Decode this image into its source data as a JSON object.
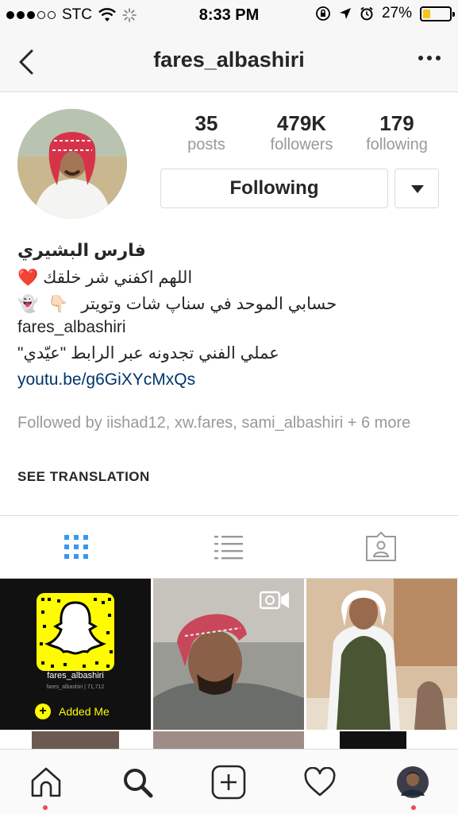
{
  "status_bar": {
    "carrier": "STC",
    "time": "8:33 PM",
    "battery_percent": "27%",
    "battery_level": 0.27,
    "signal_bars_filled": 3,
    "signal_bars_total": 5,
    "battery_color": "#f5c518"
  },
  "nav": {
    "title": "fares_albashiri",
    "back_icon": "chevron-left-icon",
    "more_icon": "more-horizontal-icon"
  },
  "profile": {
    "stats": [
      {
        "value": "35",
        "label": "posts"
      },
      {
        "value": "479K",
        "label": "followers"
      },
      {
        "value": "179",
        "label": "following"
      }
    ],
    "following_button": "Following",
    "dropdown_icon": "caret-down-icon"
  },
  "bio": {
    "name": "فارس البشيري",
    "line1": "اللهم اكفني شر خلقك",
    "line1_emoji": "❤️",
    "line2": "حسابي الموحد في سناپ شات وتويتر",
    "line2_emoji_1": "👇🏻",
    "line2_emoji_2": "👻",
    "line3": "fares_albashiri",
    "line4": "عملي الفني تجدونه عبر الرابط \"عيّدي\"",
    "link": "youtu.be/g6GiXYcMxQs"
  },
  "followed_by": "Followed by iishad12, xw.fares, sami_albashiri + 6 more",
  "see_translation": "SEE TRANSLATION",
  "tabs": [
    {
      "icon": "grid-icon",
      "active": true
    },
    {
      "icon": "list-icon",
      "active": false
    },
    {
      "icon": "tagged-icon",
      "active": false
    }
  ],
  "posts": {
    "snapcode": {
      "username": "fares_albashiri",
      "subtext": "fares_albashiri | 71,712",
      "added_label": "Added Me"
    }
  },
  "bottom_nav": [
    {
      "icon": "home-icon",
      "notification": true
    },
    {
      "icon": "search-icon",
      "notification": false
    },
    {
      "icon": "add-post-icon",
      "notification": false
    },
    {
      "icon": "heart-icon",
      "notification": false
    },
    {
      "icon": "profile-avatar-icon",
      "notification": true
    }
  ],
  "colors": {
    "accent_blue": "#3897f0",
    "link": "#003569",
    "muted": "#999999",
    "snap_yellow": "#fffc00",
    "notification_dot": "#ed4956"
  }
}
